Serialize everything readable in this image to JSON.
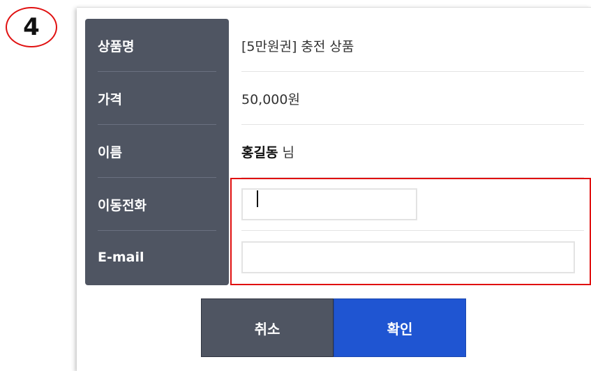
{
  "step_badge": "4",
  "form": {
    "rows": [
      {
        "label": "상품명",
        "value": "[5만원권] 충전 상품"
      },
      {
        "label": "가격",
        "value": "50,000원"
      },
      {
        "label": "이름",
        "name": "홍길동",
        "suffix": "님"
      },
      {
        "label": "이동전화",
        "input_value": ""
      },
      {
        "label": "E-mail",
        "input_value": ""
      }
    ]
  },
  "buttons": {
    "cancel": "취소",
    "confirm": "확인"
  },
  "colors": {
    "label_bg": "#4f5562",
    "confirm_bg": "#1f55d2",
    "highlight": "#e01010"
  }
}
